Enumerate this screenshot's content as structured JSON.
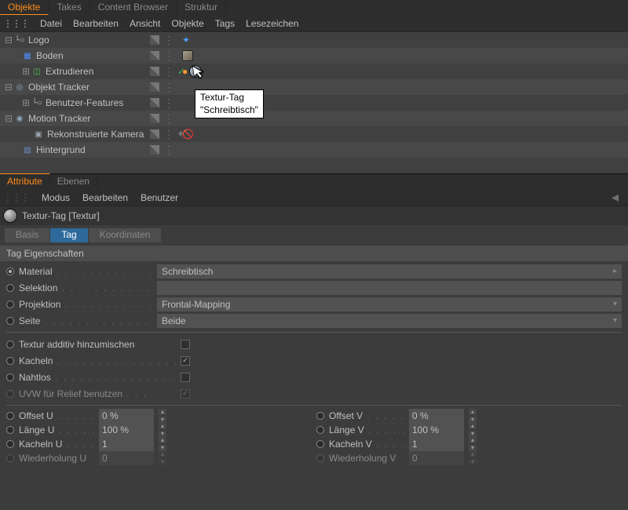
{
  "top_tabs": {
    "objekte": "Objekte",
    "takes": "Takes",
    "content": "Content Browser",
    "struktur": "Struktur"
  },
  "menu": {
    "datei": "Datei",
    "bearbeiten": "Bearbeiten",
    "ansicht": "Ansicht",
    "objekte": "Objekte",
    "tags": "Tags",
    "lesezeichen": "Lesezeichen"
  },
  "tree": {
    "logo": "Logo",
    "boden": "Boden",
    "extrudieren": "Extrudieren",
    "objekt_tracker": "Objekt Tracker",
    "benutzer_features": "Benutzer-Features",
    "motion_tracker": "Motion Tracker",
    "rek_kamera": "Rekonstruierte Kamera",
    "hintergrund": "Hintergrund"
  },
  "tooltip": {
    "l1": "Textur-Tag",
    "l2": "\"Schreibtisch\""
  },
  "attr_tabs": {
    "attribute": "Attribute",
    "ebenen": "Ebenen"
  },
  "attr_menu": {
    "modus": "Modus",
    "bearbeiten": "Bearbeiten",
    "benutzer": "Benutzer"
  },
  "chip": "Textur-Tag [Textur]",
  "subtabs": {
    "basis": "Basis",
    "tag": "Tag",
    "koord": "Koordinaten"
  },
  "section": "Tag Eigenschaften",
  "props": {
    "material_l": "Material",
    "material_v": "Schreibtisch",
    "selektion_l": "Selektion",
    "projektion_l": "Projektion",
    "projektion_v": "Frontal-Mapping",
    "seite_l": "Seite",
    "seite_v": "Beide",
    "additiv_l": "Textur additiv hinzumischen",
    "kacheln_l": "Kacheln",
    "nahtlos_l": "Nahtlos",
    "uvw_l": "UVW für Relief benutzen",
    "offset_u_l": "Offset U",
    "offset_u_v": "0 %",
    "offset_v_l": "Offset V",
    "offset_v_v": "0 %",
    "laenge_u_l": "Länge U",
    "laenge_u_v": "100 %",
    "laenge_v_l": "Länge V",
    "laenge_v_v": "100 %",
    "kacheln_u_l": "Kacheln U",
    "kacheln_u_v": "1",
    "kacheln_v_l": "Kacheln V",
    "kacheln_v_v": "1",
    "wied_u_l": "Wiederholung U",
    "wied_u_v": "0",
    "wied_v_l": "Wiederholung V",
    "wied_v_v": "0"
  }
}
